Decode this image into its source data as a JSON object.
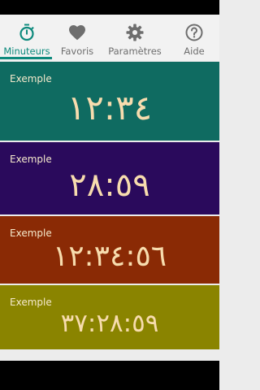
{
  "tabs": [
    {
      "label": "Minuteurs",
      "icon": "timer-icon",
      "active": true
    },
    {
      "label": "Favoris",
      "icon": "heart-icon",
      "active": false
    },
    {
      "label": "Paramètres",
      "icon": "gear-icon",
      "active": false
    },
    {
      "label": "Aide",
      "icon": "help-icon",
      "active": false
    }
  ],
  "cards": [
    {
      "label": "Exemple",
      "time": "١٢:٣٤",
      "color": "#0f6b61"
    },
    {
      "label": "Exemple",
      "time": "٢٨:٥٩",
      "color": "#2a0a5c"
    },
    {
      "label": "Exemple",
      "time": "١٢:٣٤:٥٦",
      "color": "#8a2a05"
    },
    {
      "label": "Exemple",
      "time": "٣٧:٢٨:٥٩",
      "color": "#8a8400"
    }
  ],
  "colors": {
    "accent": "#0e8a7d",
    "digits": "#f7dcae"
  }
}
